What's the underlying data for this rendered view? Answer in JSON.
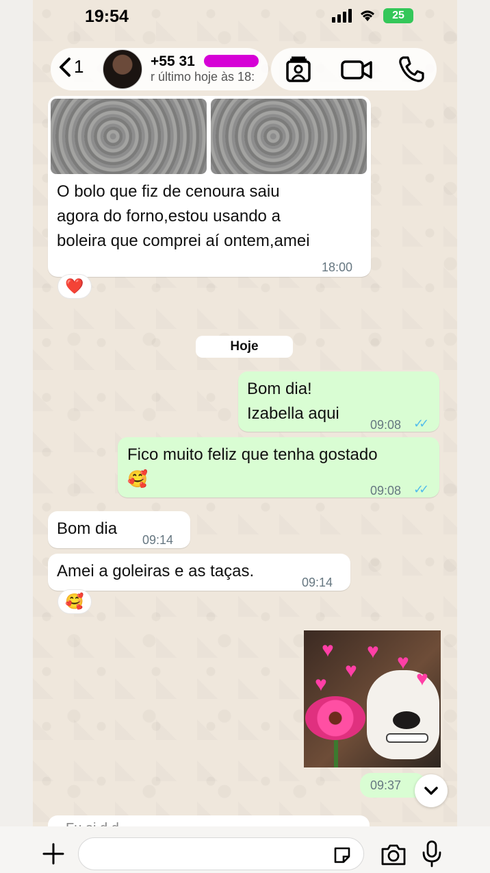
{
  "status_bar": {
    "time": "19:54",
    "battery": "25"
  },
  "header": {
    "back_count": "1",
    "contact_name": "+55 31",
    "last_seen": "r último hoje às 18:"
  },
  "messages": [
    {
      "dir": "in",
      "text": "O bolo que fiz de cenoura saiu\nagora do forno,estou usando a\nboleira que comprei aí ontem,amei",
      "time": "18:00",
      "reaction": "❤️"
    },
    {
      "dir": "out",
      "text": "Bom dia!\nIzabella aqui",
      "time": "09:08"
    },
    {
      "dir": "out",
      "text": "Fico muito feliz que tenha gostado\n🥰",
      "time": "09:08"
    },
    {
      "dir": "in",
      "text": "Bom dia",
      "time": "09:14"
    },
    {
      "dir": "in",
      "text": "Amei a goleiras e as taças.",
      "time": "09:14",
      "reaction": "🥰"
    },
    {
      "dir": "out",
      "type": "sticker",
      "time": "09:37"
    }
  ],
  "date_chip": "Hoje",
  "partial_message": "Fu    ei d  d  ",
  "composer": {
    "placeholder": ""
  },
  "icons": {
    "back": "chevron-left-icon",
    "contact_card": "contact-card-icon",
    "video": "video-camera-icon",
    "phone": "phone-icon",
    "scroll": "chevron-down-icon",
    "plus": "plus-icon",
    "sticker": "sticker-icon",
    "camera": "camera-icon",
    "mic": "microphone-icon"
  },
  "colors": {
    "outgoing": "#d9fdd3",
    "incoming": "#ffffff",
    "read_ticks": "#53bdeb",
    "battery": "#34c759"
  }
}
